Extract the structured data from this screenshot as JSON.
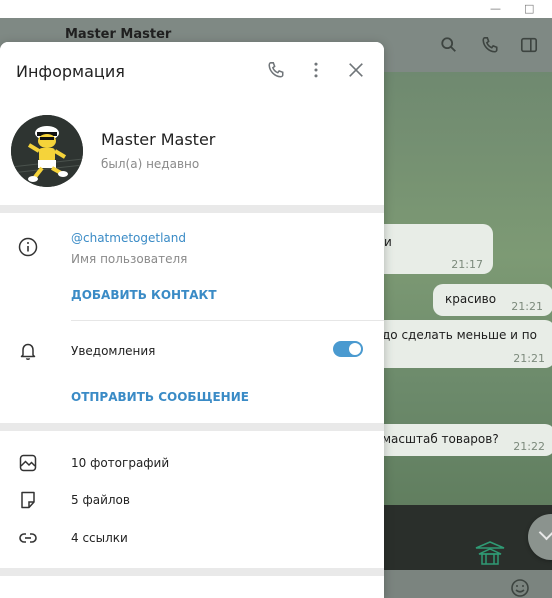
{
  "window": {
    "minimize_glyph": "—",
    "maximize_glyph": "□"
  },
  "chat": {
    "title": "Master Master",
    "messages": [
      {
        "text": "и",
        "time": "21:17"
      },
      {
        "text": "красиво",
        "time": "21:21"
      },
      {
        "text": "до сделать меньше и по",
        "time": "21:21"
      },
      {
        "text": "масштаб товаров?",
        "time": "21:22"
      }
    ]
  },
  "info_panel": {
    "title": "Информация",
    "profile": {
      "name": "Master Master",
      "status": "был(а) недавно"
    },
    "username": {
      "value": "@chatmetogetland",
      "caption": "Имя пользователя"
    },
    "add_contact_label": "ДОБАВИТЬ КОНТАКТ",
    "notifications": {
      "label": "Уведомления",
      "enabled": true
    },
    "send_message_label": "ОТПРАВИТЬ СООБЩЕНИЕ",
    "media": {
      "photos": "10 фотографий",
      "files": "5 файлов",
      "links": "4 ссылки"
    }
  },
  "colors": {
    "accent": "#3a8bc6",
    "toggle_on": "#4a9ad0"
  }
}
